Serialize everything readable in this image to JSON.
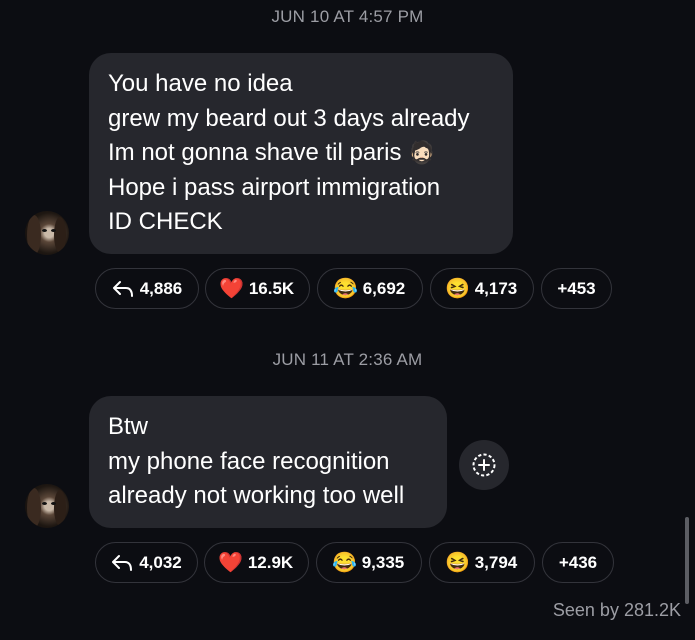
{
  "messages": [
    {
      "timestamp": "JUN 10 AT 4:57 PM",
      "lines": [
        "You have no idea",
        "grew my beard out 3 days already",
        "Im not gonna shave til paris",
        "Hope i pass airport immigration",
        "ID CHECK"
      ],
      "inline_emoji": "🧔🏻",
      "reactions": {
        "replies": "4,886",
        "heart": "16.5K",
        "laugh_cry": "6,692",
        "grin": "4,173",
        "more": "+453"
      }
    },
    {
      "timestamp": "JUN 11 AT 2:36 AM",
      "lines": [
        "Btw",
        "my phone face recognition",
        "already not working too well"
      ],
      "reactions": {
        "replies": "4,032",
        "heart": "12.9K",
        "laugh_cry": "9,335",
        "grin": "3,794",
        "more": "+436"
      }
    }
  ],
  "seen": "Seen by 281.2K",
  "icons": {
    "reply": "reply-arrow-icon",
    "heart": "❤️",
    "laugh_cry": "😂",
    "grin": "😆",
    "add_reaction": "add-reaction-icon"
  },
  "colors": {
    "background": "#0c0d12",
    "bubble": "#26272d",
    "muted_text": "#9c9da4",
    "pill_border": "#33343b"
  }
}
